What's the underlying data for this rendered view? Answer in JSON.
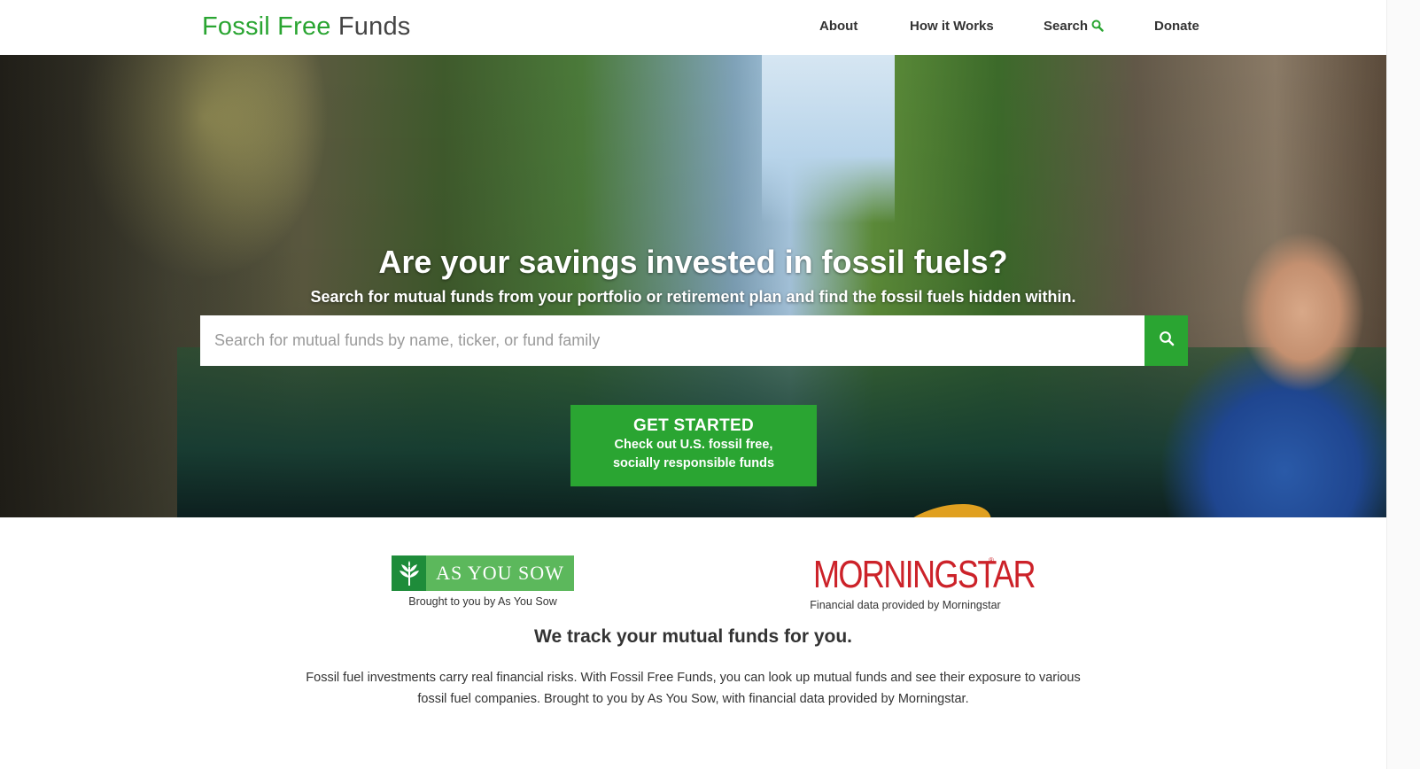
{
  "brand": {
    "part1": "Fossil Free",
    "part2": "Funds"
  },
  "nav": {
    "about": "About",
    "how_it_works": "How it Works",
    "search": "Search",
    "donate": "Donate"
  },
  "hero": {
    "title": "Are your savings invested in fossil fuels?",
    "subtitle": "Search for mutual funds from your portfolio or retirement plan and find the fossil fuels hidden within.",
    "search_placeholder": "Search for mutual funds by name, ticker, or fund family",
    "cta_title": "GET STARTED",
    "cta_line1": "Check out U.S. fossil free,",
    "cta_line2": "socially responsible funds"
  },
  "partners": {
    "as_you_sow": {
      "logo_text": "AS YOU SOW",
      "caption": "Brought to you by As You Sow"
    },
    "morningstar": {
      "logo_text": "MORNINGSTAR",
      "caption": "Financial data provided by Morningstar"
    }
  },
  "about": {
    "title": "We track your mutual funds for you.",
    "description": "Fossil fuel investments carry real financial risks. With Fossil Free Funds, you can look up mutual funds and see their exposure to various fossil fuel companies. Brought to you by As You Sow, with financial data provided by Morningstar."
  },
  "colors": {
    "brand_green": "#2aa532",
    "morningstar_red": "#cc2229"
  },
  "icons": {
    "search": "search-icon",
    "leaf": "leaf-icon"
  }
}
